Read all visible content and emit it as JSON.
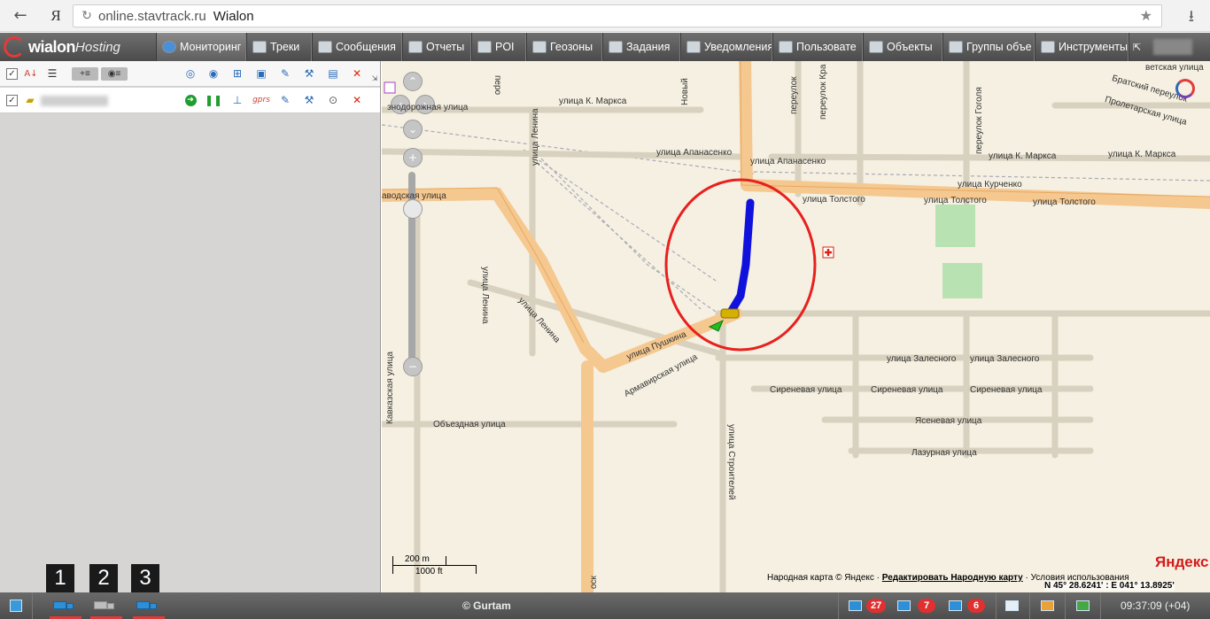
{
  "browser": {
    "back_icon": "←",
    "ya_icon": "Я",
    "reload_icon": "↻",
    "host": "online.stavtrack.ru",
    "title": "Wialon",
    "star_icon": "★",
    "download_icon": "⭳"
  },
  "app": {
    "logo_text": "wialon",
    "logo_text2": "Hosting",
    "tabs": [
      {
        "label": "Мониторинг",
        "active": true
      },
      {
        "label": "Треки"
      },
      {
        "label": "Сообщения"
      },
      {
        "label": "Отчеты"
      },
      {
        "label": "POI"
      },
      {
        "label": "Геозоны"
      },
      {
        "label": "Задания"
      },
      {
        "label": "Уведомления"
      },
      {
        "label": "Пользовате"
      },
      {
        "label": "Объекты"
      },
      {
        "label": "Группы объе"
      },
      {
        "label": "Инструменты"
      }
    ],
    "expand_icon": "⇱"
  },
  "monitoring": {
    "header_icons": {
      "check": "✓",
      "sort": "A↓",
      "list": "☰",
      "add_group": "+≡",
      "toggle": "◉≡",
      "delete": "✕"
    },
    "unit": {
      "check": "✓",
      "gprs_label": "gprs",
      "delete": "✕"
    }
  },
  "map": {
    "streets": [
      {
        "text": "улица К. Маркса"
      },
      {
        "text": "знодорожная улица"
      },
      {
        "text": "улица Апанасенко"
      },
      {
        "text": "улица Апанасенко"
      },
      {
        "text": "улица К. Маркса"
      },
      {
        "text": "улица К. Маркса"
      },
      {
        "text": "улица Курченко"
      },
      {
        "text": "улица Толстого"
      },
      {
        "text": "улица Толстого"
      },
      {
        "text": "улица Толстого"
      },
      {
        "text": "аводская улица"
      },
      {
        "text": "улица Ленина"
      },
      {
        "text": "улица Пушкина"
      },
      {
        "text": "Армавирская улица"
      },
      {
        "text": "улица Залесного"
      },
      {
        "text": "улица Залесного"
      },
      {
        "text": "Сиреневая улица"
      },
      {
        "text": "Сиреневая улица"
      },
      {
        "text": "Сиреневая улица"
      },
      {
        "text": "Ясеневая улица"
      },
      {
        "text": "Объездная улица"
      },
      {
        "text": "Лазурная улица"
      },
      {
        "text": "Братский переулок"
      },
      {
        "text": "Пролетарская улица"
      },
      {
        "text": "ветская улица"
      }
    ],
    "vstreets": [
      {
        "text": "улица Ленина"
      },
      {
        "text": "улица Ленина"
      },
      {
        "text": "Кавказская улица"
      },
      {
        "text": "улица Строителей"
      },
      {
        "text": "переулок Гоголя"
      },
      {
        "text": "переулок Кра"
      },
      {
        "text": "переулок"
      },
      {
        "text": "Новый"
      },
      {
        "text": "перо"
      },
      {
        "text": "оск"
      }
    ],
    "scale_m": "200 m",
    "scale_ft": "1000 ft",
    "yandex": "Яндекс",
    "copyright_prefix": "Народная карта © Яндекс ·",
    "copyright_link": "Редактировать Народную карту",
    "copyright_suffix": "· Условия использования",
    "coords": "N 45° 28.6241' : E 041° 13.8925'",
    "track_color": "#1111dd",
    "circle_color": "#e8201f"
  },
  "taskbar": {
    "labels": [
      "1",
      "2",
      "3"
    ],
    "gurtam": "© Gurtam",
    "badges": [
      "27",
      "7",
      "6"
    ],
    "clock": "09:37:09 (+04)"
  }
}
